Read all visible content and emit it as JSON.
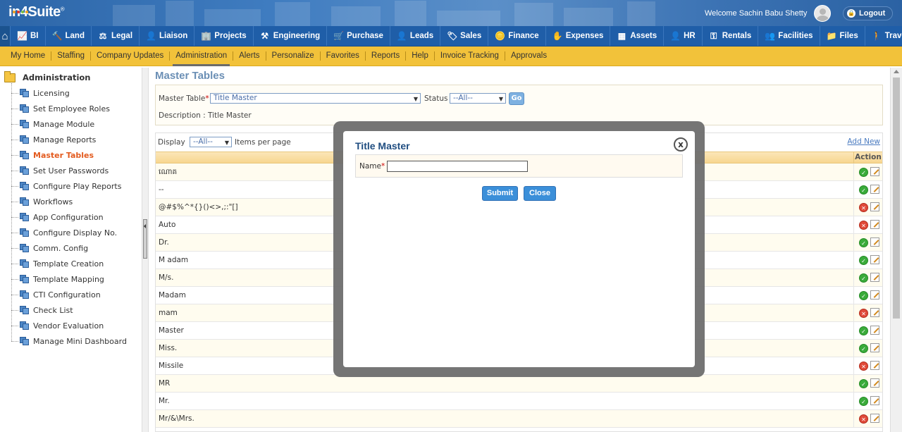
{
  "header": {
    "logo_text": "in4Suite",
    "logo_mark": "®",
    "welcome": "Welcome Sachin Babu Shetty",
    "logout_label": "Logout"
  },
  "main_nav": [
    {
      "label": "",
      "icon": "home-icon"
    },
    {
      "label": "BI",
      "icon": "chart-icon"
    },
    {
      "label": "Land",
      "icon": "hammer-icon"
    },
    {
      "label": "Legal",
      "icon": "scales-icon"
    },
    {
      "label": "Liaison",
      "icon": "person-icon"
    },
    {
      "label": "Projects",
      "icon": "building-icon"
    },
    {
      "label": "Engineering",
      "icon": "tools-icon"
    },
    {
      "label": "Purchase",
      "icon": "cart-icon"
    },
    {
      "label": "Leads",
      "icon": "person-icon"
    },
    {
      "label": "Sales",
      "icon": "tag-icon"
    },
    {
      "label": "Finance",
      "icon": "coins-icon"
    },
    {
      "label": "Expenses",
      "icon": "hand-coin-icon"
    },
    {
      "label": "Assets",
      "icon": "box-icon"
    },
    {
      "label": "HR",
      "icon": "person-clock-icon"
    },
    {
      "label": "Rentals",
      "icon": "key-icon"
    },
    {
      "label": "Facilities",
      "icon": "people-icon"
    },
    {
      "label": "Files",
      "icon": "folder-icon"
    },
    {
      "label": "Travel",
      "icon": "walker-icon"
    }
  ],
  "sub_nav": [
    "My Home",
    "Staffing",
    "Company Updates",
    "Administration",
    "Alerts",
    "Personalize",
    "Favorites",
    "Reports",
    "Help",
    "Invoice Tracking",
    "Approvals"
  ],
  "sub_nav_active": "Administration",
  "sidebar": {
    "root": "Administration",
    "items": [
      "Licensing",
      "Set Employee Roles",
      "Manage Module",
      "Manage Reports",
      "Master Tables",
      "Set User Passwords",
      "Configure Play Reports",
      "Workflows",
      "App Configuration",
      "Configure Display No.",
      "Comm. Config",
      "Template Creation",
      "Template Mapping",
      "CTI Configuration",
      "Check List",
      "Vendor Evaluation",
      "Manage Mini Dashboard"
    ],
    "active": "Master Tables"
  },
  "content": {
    "title": "Master Tables",
    "master_table_label": "Master Table",
    "master_table_value": "Title Master",
    "status_label": "Status",
    "status_value": "--All--",
    "go_label": "Go",
    "description": "Description : Title Master",
    "display_label": "Display",
    "display_value": "--All--",
    "items_per_page": "Items per page",
    "add_new": "Add New",
    "action_header": "Action",
    "rows": [
      {
        "name": "ណោគ",
        "active": true
      },
      {
        "name": "--",
        "active": true
      },
      {
        "name": "@#$%^*{}()<>,;:\"[]",
        "active": false
      },
      {
        "name": "Auto",
        "active": false
      },
      {
        "name": "Dr.",
        "active": true
      },
      {
        "name": "M adam",
        "active": true
      },
      {
        "name": "M/s.",
        "active": true
      },
      {
        "name": "Madam",
        "active": true
      },
      {
        "name": "mam",
        "active": false
      },
      {
        "name": "Master",
        "active": true
      },
      {
        "name": "Miss.",
        "active": true
      },
      {
        "name": "Missile",
        "active": false
      },
      {
        "name": "MR",
        "active": true
      },
      {
        "name": "Mr.",
        "active": true
      },
      {
        "name": "Mr/&\\Mrs.",
        "active": false
      }
    ]
  },
  "modal": {
    "title": "Title Master",
    "name_label": "Name",
    "name_value": "",
    "submit_label": "Submit",
    "close_label": "Close",
    "close_glyph": "x"
  }
}
